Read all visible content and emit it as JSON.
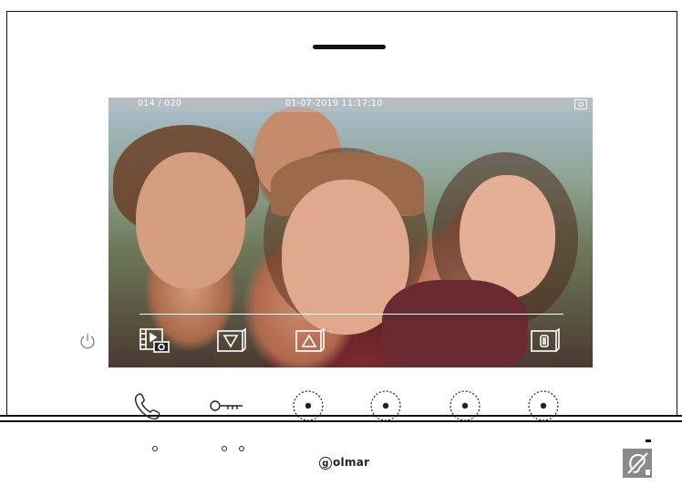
{
  "screen": {
    "status": {
      "counter": "014 / 020",
      "datetime": "01-07-2019   11:17:10",
      "sd_icon": "sd-card-icon"
    },
    "toolbar": [
      {
        "icon": "film-camera-icon",
        "action": "view-images"
      },
      {
        "icon": "arrow-down-box-icon",
        "action": "previous"
      },
      {
        "icon": "arrow-up-box-icon",
        "action": "next"
      },
      {
        "icon": "trash-icon",
        "action": "delete"
      }
    ]
  },
  "power_icon": "power-icon",
  "buttons": [
    {
      "icon": "phone-icon"
    },
    {
      "icon": "key-icon"
    },
    {
      "icon": "circle-button-icon"
    },
    {
      "icon": "circle-button-icon"
    },
    {
      "icon": "circle-button-icon"
    },
    {
      "icon": "circle-button-icon"
    }
  ],
  "brand": {
    "logo_letter": "g",
    "name": "olmar"
  },
  "hearing_loop_icon": "hearing-loop-icon"
}
